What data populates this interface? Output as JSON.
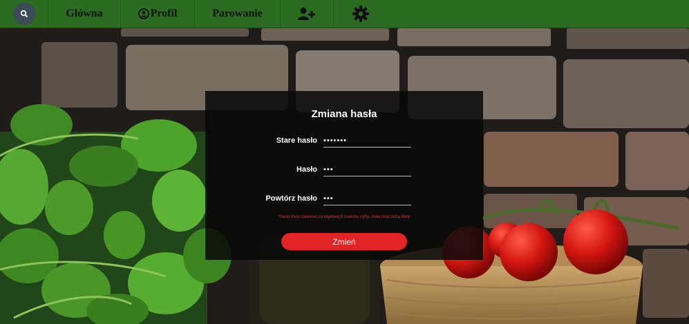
{
  "navbar": {
    "search_icon": "search-icon",
    "home_label": "Główna",
    "profile_label": "Profil",
    "profile_icon": "user-circle-icon",
    "pairing_label": "Parowanie",
    "add_user_icon": "user-plus-icon",
    "settings_icon": "gear-icon"
  },
  "form": {
    "title": "Zmiana hasła",
    "old_password_label": "Stare hasło",
    "old_password_value": "•••••••",
    "password_label": "Hasło",
    "password_value": "•••",
    "repeat_password_label": "Powtórz hasło",
    "repeat_password_value": "•••",
    "hint": "*hasło musi zawierać co najmniej 8 znaków, cyfrę, małą oraz dużą literę",
    "submit_label": "Zmień"
  },
  "colors": {
    "navbar": "#2b6b22",
    "button": "#e22426",
    "hint": "#e0322c"
  }
}
